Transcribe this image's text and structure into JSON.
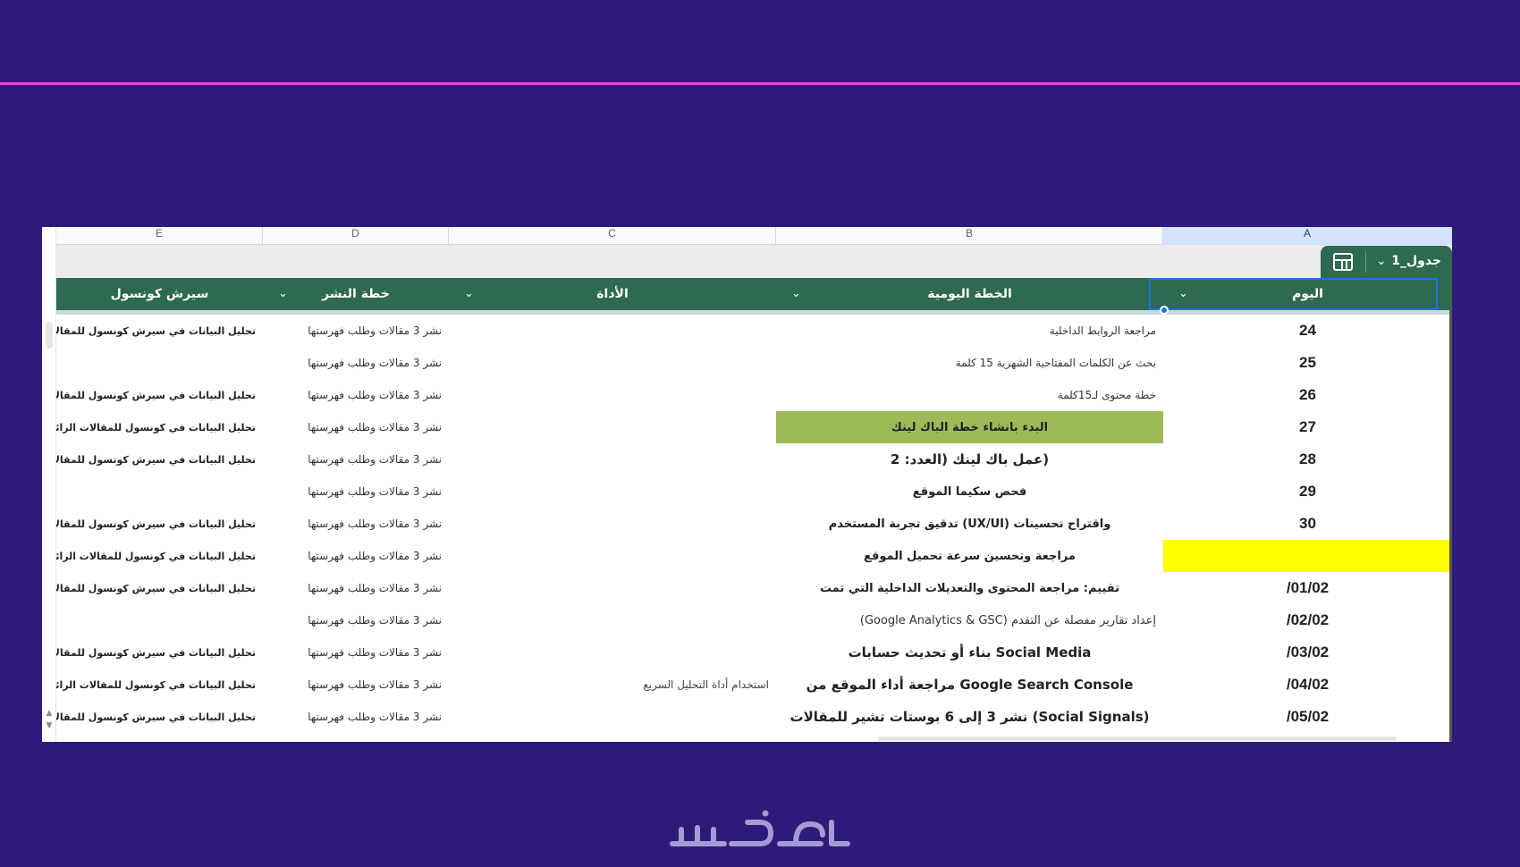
{
  "column_letters": [
    "E",
    "D",
    "C",
    "B",
    "A"
  ],
  "table_name": "جدول_1",
  "headers": {
    "e": "سيرش كونسول",
    "d": "خطة النشر",
    "c": "الأداة",
    "b": "الخطة اليومية",
    "a": "اليوم"
  },
  "rows": [
    {
      "a": "24",
      "b": "مراجعة الروابط الداخلية",
      "c": "",
      "d": "نشر 3 مقالات وطلب فهرستها",
      "e": "تحليل البيانات في سيرش كونسول للمقالات"
    },
    {
      "a": "25",
      "b": "بحث عن الكلمات المفتاحية الشهرية 15 كلمة",
      "c": "",
      "d": "نشر 3 مقالات وطلب فهرستها",
      "e": ""
    },
    {
      "a": "26",
      "b": "خطة محتوى لـ15كلمة",
      "c": "",
      "d": "نشر 3 مقالات وطلب فهرستها",
      "e": "تحليل البيانات في سيرش كونسول للمقالات"
    },
    {
      "a": "27",
      "b": "البدء بانشاء خطة الباك لينك",
      "c": "",
      "d": "نشر 3 مقالات وطلب فهرستها",
      "e": "تحليل البيانات في كونسول للمقالات الرائجة"
    },
    {
      "a": "28",
      "b": "(عمل باك لينك (العدد: 2",
      "c": "",
      "d": "نشر 3 مقالات وطلب فهرستها",
      "e": "تحليل البيانات في سيرش كونسول للمقالات"
    },
    {
      "a": "29",
      "b": "فحص سكيما الموقع",
      "c": "",
      "d": "نشر 3 مقالات وطلب فهرستها",
      "e": ""
    },
    {
      "a": "30",
      "b": "واقتراح تحسينات (UX/UI) تدقيق تجربة المستخدم",
      "c": "",
      "d": "نشر 3 مقالات وطلب فهرستها",
      "e": "تحليل البيانات في سيرش كونسول للمقالات"
    },
    {
      "a": "",
      "b": "مراجعة وتحسين سرعة تحميل الموقع",
      "c": "",
      "d": "نشر 3 مقالات وطلب فهرستها",
      "e": "تحليل البيانات في كونسول للمقالات الرائجة"
    },
    {
      "a": "01/02/",
      "b": "تقييم: مراجعة المحتوى والتعديلات الداخلية التي تمت",
      "c": "",
      "d": "نشر 3 مقالات وطلب فهرستها",
      "e": "تحليل البيانات في سيرش كونسول للمقالات"
    },
    {
      "a": "02/02/",
      "b": "إعداد تقارير مفصلة عن التقدم (Google Analytics & GSC)",
      "c": "",
      "d": "نشر 3 مقالات وطلب فهرستها",
      "e": ""
    },
    {
      "a": "03/02/",
      "b": "Social Media بناء أو تحديث حسابات",
      "c": "",
      "d": "نشر 3 مقالات وطلب فهرستها",
      "e": "تحليل البيانات في سيرش كونسول للمقالات"
    },
    {
      "a": "04/02/",
      "b": "Google Search Console مراجعة أداء الموقع من",
      "c": "استخدام أداة التحليل السريع",
      "d": "نشر 3 مقالات وطلب فهرستها",
      "e": "تحليل البيانات في كونسول للمقالات الرائجة"
    },
    {
      "a": "05/02/",
      "b": "(Social Signals) نشر 3 إلى 6 بوستات تشير للمقالات",
      "c": "",
      "d": "نشر 3 مقالات وطلب فهرستها",
      "e": "تحليل البيانات في سيرش كونسول للمقالات"
    }
  ],
  "colors": {
    "background": "#2e1a78",
    "accent_line": "#d84ee8",
    "header_green": "#2d6a4f",
    "highlight_green": "#9bbb59",
    "highlight_yellow": "#ffff00",
    "selection_blue": "#1a73e8"
  },
  "icons": {
    "table_tab": "table-grid-icon",
    "dropdown": "chevron-down-icon"
  }
}
